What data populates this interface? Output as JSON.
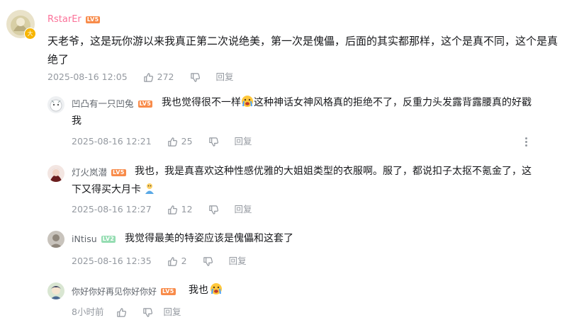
{
  "colors": {
    "main_author_name": "#fb7299",
    "reply_author_name": "#61666d",
    "meta_text": "#9499a0",
    "level_5": "#ff6699",
    "level_5_alt": "#f88b4a",
    "level_2": "#95ddb2",
    "badge_gold": "#f7b500"
  },
  "main_comment": {
    "author": "RstarEr",
    "level": "LV5",
    "avatar_badge": "大",
    "text_line1": "天老爷，这是玩你游以来我真正第二次说绝美，第一次是傀儡，后面的其实都那样，这个是真不同，这个是真",
    "text_line2": "绝了",
    "time": "2025-08-16 12:05",
    "likes": "272",
    "reply_label": "回复"
  },
  "replies": [
    {
      "author": "凹凸有一只凹兔",
      "level": "LV5",
      "text_a": "我也觉得很不一样",
      "text_b": "这种神话女神风格真的拒绝不了，反重力头发露背露腰真的好戳",
      "text_line2": "我",
      "time": "2025-08-16 12:21",
      "likes": "25",
      "reply_label": "回复"
    },
    {
      "author": "灯火岚潜",
      "level": "LV5",
      "text_line1": "我也，我是真喜欢这种性感优雅的大姐姐类型的衣服啊。服了，都说扣子太抠不氪金了，这",
      "text_line2": "下又得买大月卡",
      "time": "2025-08-16 12:27",
      "likes": "12",
      "reply_label": "回复"
    },
    {
      "author": "iNtisu",
      "level": "LV2",
      "text_line1": "我觉得最美的特姿应该是傀儡和这套了",
      "time": "2025-08-16 12:35",
      "likes": "2",
      "reply_label": "回复"
    },
    {
      "author": "你好你好再见你好你好",
      "level": "LV5",
      "text_line1": "我也",
      "time": "8小时前",
      "likes": "",
      "reply_label": "回复"
    }
  ]
}
